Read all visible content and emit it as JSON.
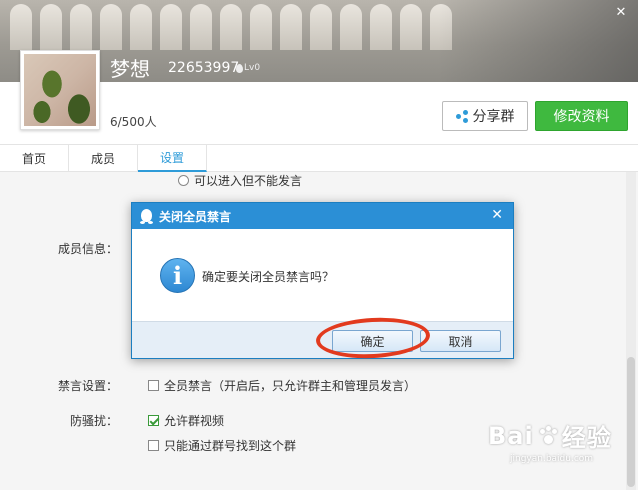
{
  "window": {
    "close_glyph": "✕"
  },
  "profile": {
    "group_name": "梦想",
    "group_id": "22653997",
    "level_badge": "Lv0",
    "member_count": "6/500人",
    "share_label": "分享群",
    "edit_label": "修改资料"
  },
  "tabs": [
    {
      "label": "首页",
      "active": false
    },
    {
      "label": "成员",
      "active": false
    },
    {
      "label": "设置",
      "active": true
    }
  ],
  "settings": {
    "radio_option_1": "可以进入但不能发言",
    "members_info_label": "成员信息：",
    "mute_label": "禁言设置：",
    "mute_all_option": "全员禁言（开启后，只允许群主和管理员发言）",
    "anti_harass_label": "防骚扰：",
    "allow_video": "允许群视频",
    "search_only_by_id": "只能通过群号找到这个群"
  },
  "dialog": {
    "title": "关闭全员禁言",
    "close_glyph": "✕",
    "message": "确定要关闭全员禁言吗？",
    "ok_label": "确定",
    "cancel_label": "取消"
  },
  "watermark": {
    "brand": "Bai",
    "brand_suffix": "经验",
    "url": "jingyan.baidu.com"
  },
  "colors": {
    "accent_blue": "#2b8fd6",
    "green_button": "#3fb93f",
    "highlight_ring": "#e23a1e"
  }
}
